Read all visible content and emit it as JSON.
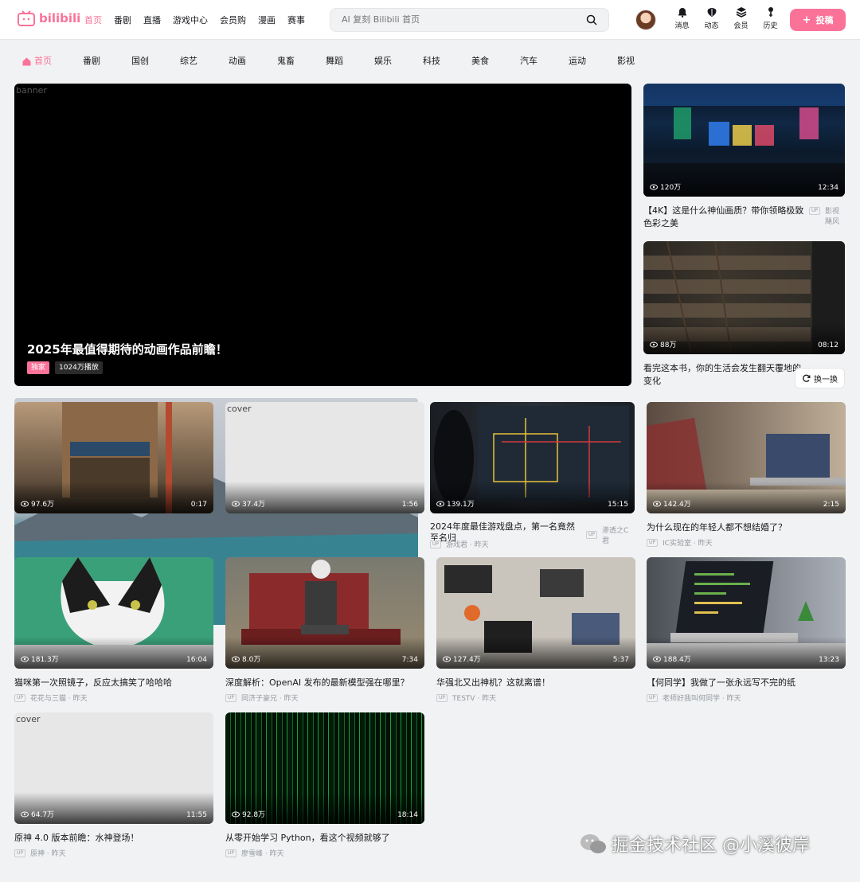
{
  "header": {
    "logo_text": "bilibili",
    "nav": [
      "首页",
      "番剧",
      "直播",
      "游戏中心",
      "会员购",
      "漫画",
      "赛事"
    ],
    "search_placeholder": "AI 复刻 Bilibili 首页",
    "icons": [
      {
        "label": "消息",
        "icon": "bell-icon"
      },
      {
        "label": "动态",
        "icon": "wind-icon"
      },
      {
        "label": "会员",
        "icon": "layers-icon"
      },
      {
        "label": "历史",
        "icon": "history-icon"
      }
    ],
    "post_label": "投稿"
  },
  "categories": [
    "首页",
    "番剧",
    "国创",
    "综艺",
    "动画",
    "鬼畜",
    "舞蹈",
    "娱乐",
    "科技",
    "美食",
    "汽车",
    "运动",
    "影视"
  ],
  "banner": {
    "alt": "banner",
    "title": "2025年最值得期待的动画作品前瞻！",
    "tag_exclusive": "独家",
    "plays": "1024万播放"
  },
  "side": [
    {
      "views": "120万",
      "duration": "12:34",
      "title": "【4K】这是什么神仙画质？带你领略极致色彩之美",
      "up": "影视飓风"
    },
    {
      "views": "88万",
      "duration": "08:12",
      "title": "看完这本书，你的生活会发生翻天覆地的变化",
      "up": ""
    }
  ],
  "refresh_label": "换一换",
  "videos": [
    {
      "views": "97.6万",
      "duration": "0:17",
      "title": "",
      "meta": ""
    },
    {
      "views": "37.4万",
      "duration": "1:56",
      "title": "",
      "meta": "",
      "alt": "cover"
    },
    {
      "views": "139.1万",
      "duration": "15:15",
      "title": "2024年度最佳游戏盘点，第一名竟然至名归",
      "meta": "游戏君 · 昨天",
      "meta2": "渗透之C君"
    },
    {
      "views": "142.4万",
      "duration": "2:15",
      "title": "为什么现在的年轻人都不想结婚了？",
      "meta": "IC实验室 · 昨天"
    },
    {
      "views": "181.3万",
      "duration": "16:04",
      "title": "猫咪第一次照镜子，反应太搞笑了哈哈哈",
      "meta": "花花与三猫 · 昨天"
    },
    {
      "views": "8.0万",
      "duration": "7:34",
      "title": "深度解析：OpenAI 发布的最新模型强在哪里？",
      "meta": "同济子豪兄 · 昨天"
    },
    {
      "views": "127.4万",
      "duration": "5:37",
      "title": "华强北又出神机？这就离谱！",
      "meta": "TESTV · 昨天"
    },
    {
      "views": "188.4万",
      "duration": "13:23",
      "title": "【何同学】我做了一张永远写不完的纸",
      "meta": "老师好我叫何同学 · 昨天"
    },
    {
      "views": "64.7万",
      "duration": "11:55",
      "title": "原神 4.0 版本前瞻：水神登场！",
      "meta": "原神 · 昨天",
      "alt": "cover"
    },
    {
      "views": "92.8万",
      "duration": "18:14",
      "title": "从零开始学习 Python，看这个视频就够了",
      "meta": "廖雪峰 · 昨天"
    }
  ],
  "up_badge": "UP",
  "watermark": "掘金技术社区 @小溪彼岸",
  "colors": {
    "brand": "#fb7299",
    "bg": "#f1f2f3"
  }
}
